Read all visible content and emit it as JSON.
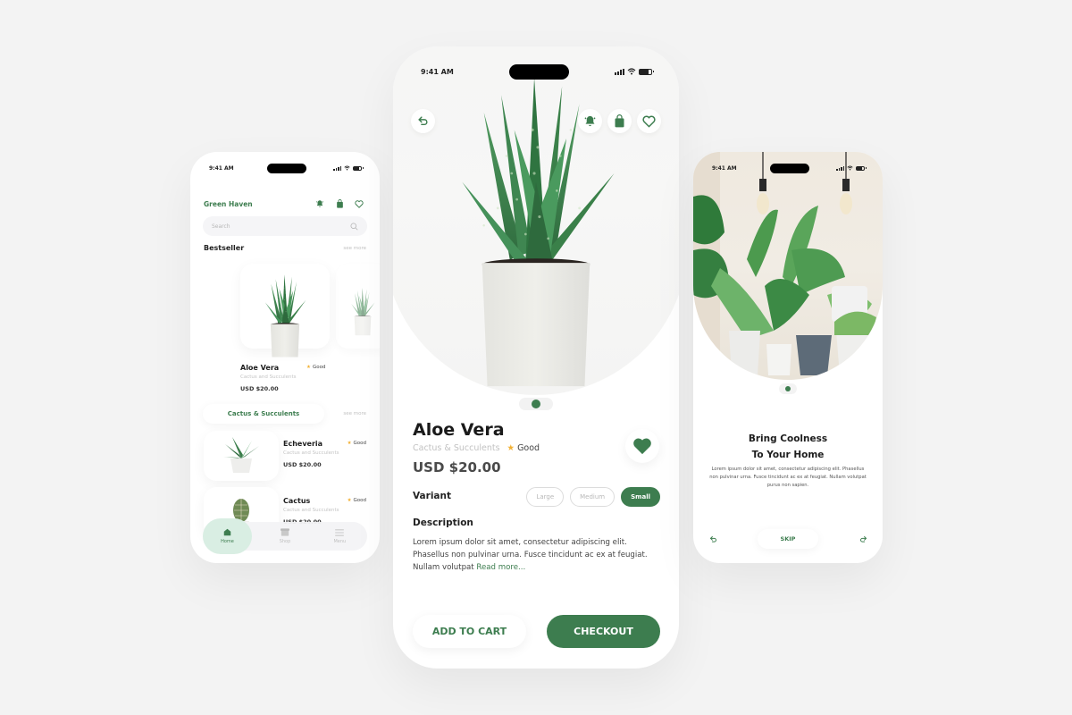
{
  "theme": {
    "accent": "#3d7d4f",
    "accent_light": "#d9eee3",
    "star": "#f2b134",
    "background": "#f3f3f3"
  },
  "status_bar": {
    "time": "9:41 AM",
    "icons": [
      "signal-icon",
      "wifi-icon",
      "battery-icon"
    ]
  },
  "home_screen": {
    "brand": "Green Haven",
    "header_icons": [
      "bell-icon",
      "shopping-bag-icon",
      "heart-icon"
    ],
    "search": {
      "placeholder": "Search",
      "icon": "search-icon"
    },
    "bestseller": {
      "title": "Bestseller",
      "see_more": "see more",
      "featured": {
        "name": "Aloe Vera",
        "category": "Cactus and Succulents",
        "price": "USD $20.00",
        "rating": "Good"
      }
    },
    "category_section": {
      "title": "Cactus & Succulents",
      "see_more": "see more",
      "items": [
        {
          "name": "Echeveria",
          "category": "Cactus and Succulents",
          "price": "USD $20.00",
          "rating": "Good"
        },
        {
          "name": "Cactus",
          "category": "Cactus and Succulents",
          "price": "USD $20.00",
          "rating": "Good"
        }
      ]
    },
    "nav": [
      {
        "label": "Home",
        "icon": "home-icon",
        "active": true
      },
      {
        "label": "Shop",
        "icon": "shop-icon",
        "active": false
      },
      {
        "label": "Menu",
        "icon": "menu-icon",
        "active": false
      }
    ]
  },
  "detail_screen": {
    "top_icons": {
      "back": "back-icon",
      "right": [
        "bell-icon",
        "shopping-bag-icon",
        "heart-icon"
      ]
    },
    "carousel": {
      "count": 1,
      "active": 0
    },
    "product": {
      "name": "Aloe Vera",
      "category": "Cactus & Succulents",
      "rating": "Good",
      "price": "USD $20.00",
      "favorited": true
    },
    "variant": {
      "label": "Variant",
      "options": [
        "Large",
        "Medium",
        "Small"
      ],
      "selected": "Small"
    },
    "description": {
      "title": "Description",
      "text": "Lorem ipsum dolor sit amet, consectetur adipiscing elit. Phasellus non pulvinar urna. Fusce tincidunt ac ex at feugiat. Nullam volutpat ",
      "read_more": "Read more..."
    },
    "buttons": {
      "add_to_cart": "ADD TO CART",
      "checkout": "CHECKOUT"
    }
  },
  "onboarding_screen": {
    "carousel": {
      "count": 1,
      "active": 0
    },
    "title_line1": "Bring Coolness",
    "title_line2": "To Your Home",
    "text": "Lorem ipsum dolor sit amet, consectetur adipiscing elit. Phasellus non pulvinar urna. Fusce tincidunt ac ex at feugiat. Nullam volutpat purus non sapien.",
    "skip": "SKIP",
    "back_icon": "undo-icon",
    "next_icon": "redo-icon"
  }
}
